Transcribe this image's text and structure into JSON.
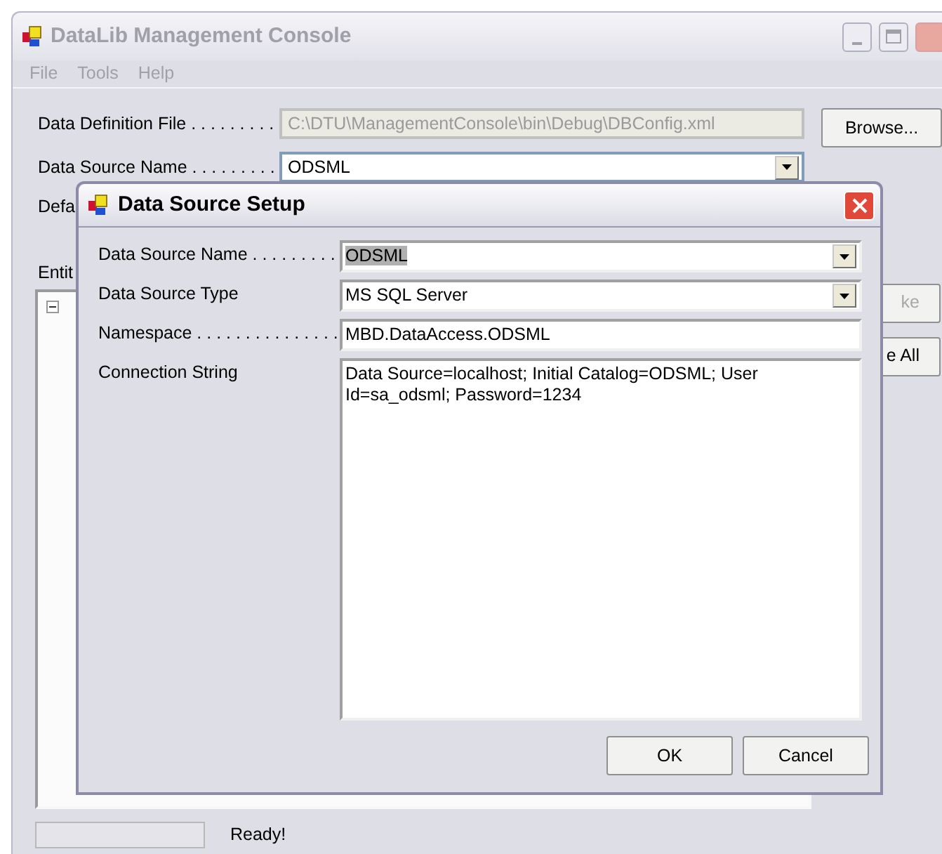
{
  "main_window": {
    "title": "DataLib Management Console",
    "active": false,
    "menu": [
      "File",
      "Tools",
      "Help"
    ],
    "fields": [
      {
        "label": "Data Definition File . . . . . . . . .",
        "value": "C:\\DTU\\ManagementConsole\\bin\\Debug\\DBConfig.xml",
        "kind": "text",
        "disabled": true
      },
      {
        "label": "Data Source Name . . . . . . . . .",
        "value": "ODSML",
        "kind": "dropdown",
        "disabled": false
      }
    ],
    "browse_button": "Browse...",
    "partial_label": "Defa",
    "entities_label": "Entit",
    "side_buttons": [
      {
        "label": "ke",
        "disabled": true
      },
      {
        "label": "e All",
        "disabled": false
      }
    ],
    "status_bar": {
      "text": "Ready!",
      "level": 0
    }
  },
  "dialog": {
    "title": "Data Source Setup",
    "active": true,
    "fields": [
      {
        "label": "Data Source Name . . . . . . . . .",
        "value": "ODSML",
        "kind": "dropdown",
        "text_selected": true
      },
      {
        "label": "Data Source Type",
        "value": "MS SQL Server",
        "kind": "dropdown",
        "text_selected": false
      },
      {
        "label": "Namespace . . . . . . . . . . . . . . .",
        "value": "MBD.DataAccess.ODSML",
        "kind": "text",
        "text_selected": false
      },
      {
        "label": "Connection String",
        "value": "Data Source=localhost; Initial Catalog=ODSML; User Id=sa_odsml; Password=1234",
        "kind": "multiline",
        "text_selected": false
      }
    ],
    "buttons": [
      "OK",
      "Cancel"
    ]
  }
}
